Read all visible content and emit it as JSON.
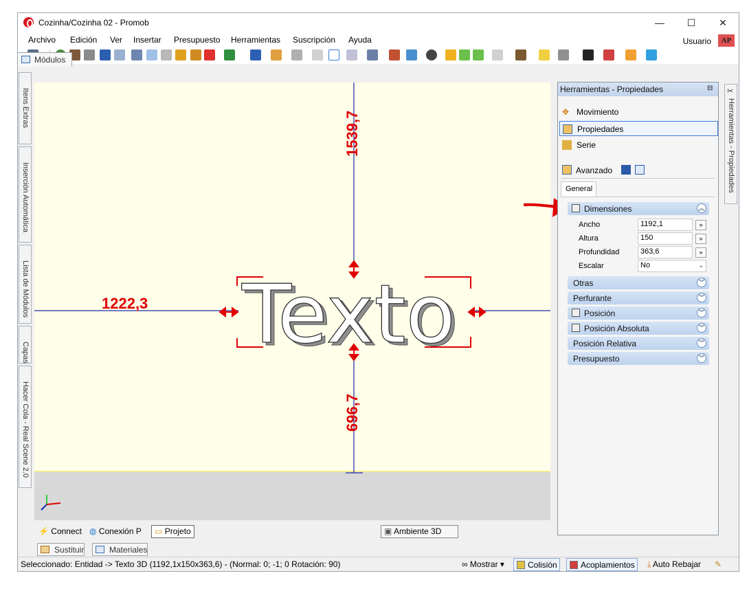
{
  "window": {
    "title": "Cozinha/Cozinha 02 - Promob",
    "minimize": "—",
    "maximize": "☐",
    "close": "✕"
  },
  "menu": {
    "items": [
      "Archivo",
      "Edición",
      "Ver",
      "Insertar",
      "Presupuesto",
      "Herramientas",
      "Suscripción",
      "Ayuda"
    ],
    "user": "Usuario",
    "user_badge": "AP"
  },
  "tabs": {
    "modulos": "Módulos"
  },
  "left_tabs": [
    "Itens Extras",
    "Inserción Automática",
    "Lista de Módulos",
    "Capas",
    "Hacer Cola - Real Scene 2.0"
  ],
  "viewport": {
    "text_3d": "Texto",
    "dim_top": "1539,7",
    "dim_left": "1222,3",
    "dim_bottom": "696,7"
  },
  "viewport_tabs": {
    "connect": "Connect",
    "conexion": "Conexión P",
    "projeto": "Projeto",
    "ambiente": "Ambiente 3D"
  },
  "panel": {
    "title": "Herramientas - Propiedades",
    "items": [
      "Movimiento",
      "Propiedades",
      "Serie"
    ],
    "advanced": "Avanzado",
    "general_tab": "General",
    "dimensions_group": "Dimensiones",
    "props": [
      {
        "label": "Ancho",
        "value": "1192,1",
        "button": "»"
      },
      {
        "label": "Altura",
        "value": "150",
        "button": "»"
      },
      {
        "label": "Profundidad",
        "value": "363,6",
        "button": "»"
      },
      {
        "label": "Escalar",
        "value": "No",
        "button": ""
      }
    ],
    "collapsed_groups": [
      "Otras",
      "Perfurante",
      "Posición",
      "Posición Absoluta",
      "Posición Relativa",
      "Presupuesto"
    ]
  },
  "right_tab": "Herramientas - Propiedades",
  "bottom_tabs": {
    "sustituir": "Sustituir",
    "materiales": "Materiales"
  },
  "status": {
    "text": "Seleccionado: Entidad -> Texto 3D (1192,1x150x363,6) - (Normal: 0; -1; 0 Rotación: 90)",
    "mostrar": "Mostrar ▾",
    "colision": "Colisión",
    "acoplamientos": "Acoplamientos",
    "auto_rebajar": "Auto Rebajar"
  },
  "colors": {
    "accent": "#3b7dd8",
    "dimension": "#e00000",
    "axis": "#1a2aa8",
    "viewport_bg": "#ffffe9"
  }
}
